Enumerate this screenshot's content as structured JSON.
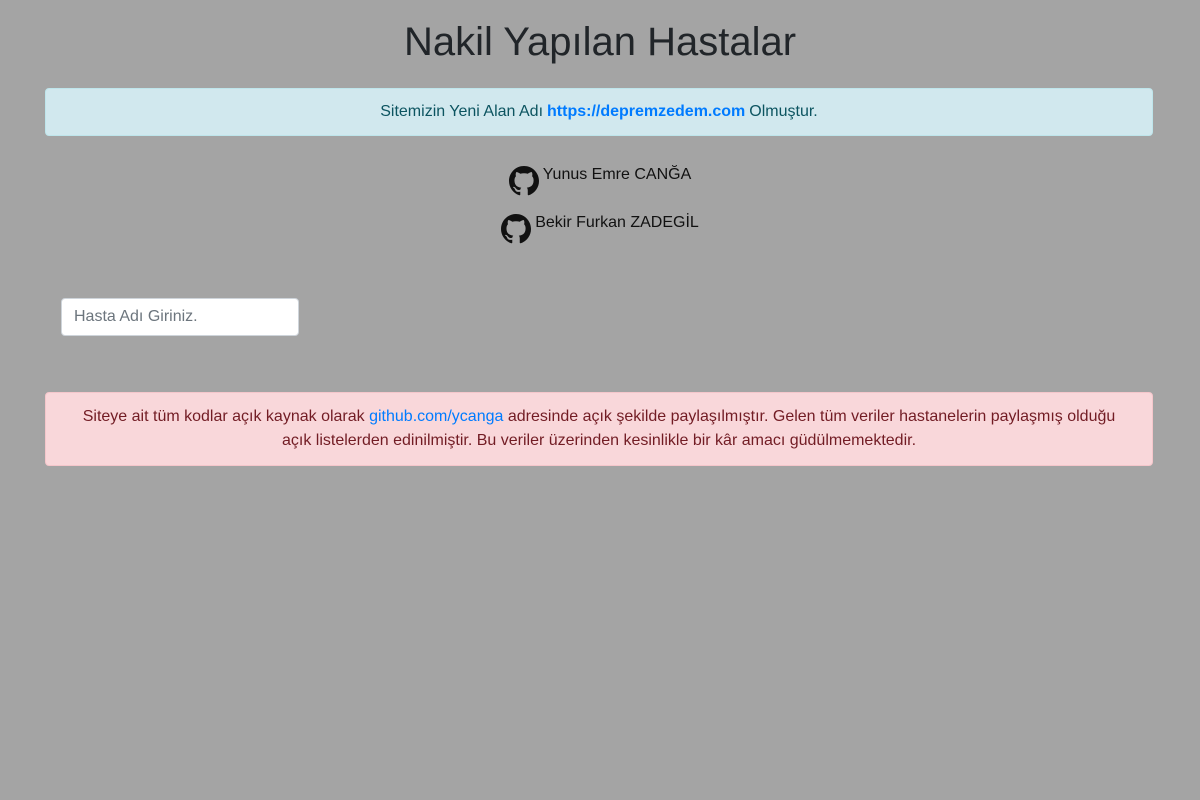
{
  "page": {
    "title": "Nakil Yapılan Hastalar"
  },
  "info_alert": {
    "prefix": "Sitemizin Yeni Alan Adı",
    "link": "https://depremzedem.com",
    "suffix": "Olmuştur."
  },
  "authors": [
    {
      "icon": "github-icon",
      "name": "Yunus Emre CANĞA"
    },
    {
      "icon": "github-icon",
      "name": "Bekir Furkan ZADEGİL"
    }
  ],
  "search": {
    "placeholder": "Hasta Adı Giriniz.",
    "value": ""
  },
  "danger_alert": {
    "part1": "Siteye ait tüm kodlar açık kaynak olarak",
    "link": "github.com/ycanga",
    "part2": "adresinde açık şekilde paylaşılmıştır. Gelen tüm veriler hastanelerin paylaşmış olduğu açık listelerden edinilmiştir. Bu veriler üzerinden kesinlikle bir kâr amacı güdülmemektedir."
  },
  "colors": {
    "background": "#a4a4a4",
    "info_bg": "#d1e8ee",
    "danger_bg": "#f9d7da",
    "link": "#007bff"
  }
}
